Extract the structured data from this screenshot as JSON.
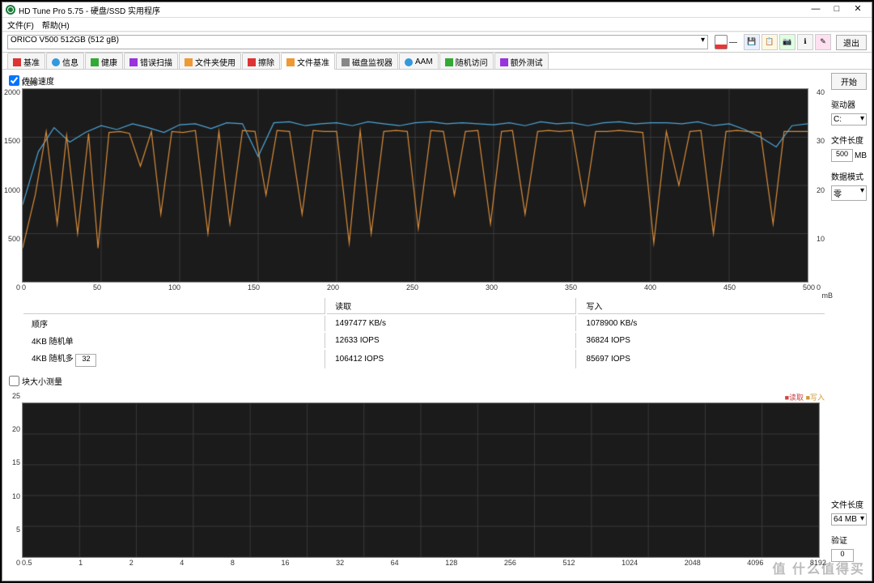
{
  "title": "HD Tune Pro 5.75 - 硬盘/SSD 实用程序",
  "menu": {
    "file": "文件(F)",
    "help": "帮助(H)"
  },
  "drive": "ORICO V500 512GB (512 gB)",
  "exit_btn": "退出",
  "tabs": [
    {
      "label": "基准"
    },
    {
      "label": "信息"
    },
    {
      "label": "健康"
    },
    {
      "label": "错误扫描"
    },
    {
      "label": "文件夹使用"
    },
    {
      "label": "擦除"
    },
    {
      "label": "文件基准"
    },
    {
      "label": "磁盘监视器"
    },
    {
      "label": "AAM"
    },
    {
      "label": "随机访问"
    },
    {
      "label": "额外测试"
    }
  ],
  "active_tab": 6,
  "checkbox1": {
    "label": "传输速度",
    "checked": true
  },
  "checkbox2": {
    "label": "块大小测量",
    "checked": false
  },
  "start_btn": "开始",
  "sidebar": {
    "drive_label": "驱动器",
    "drive_value": "C:",
    "filelen_label": "文件长度",
    "filelen_value": "500",
    "filelen_unit": "MB",
    "datamode_label": "数据模式",
    "datamode_value": "零",
    "filelen2_label": "文件长度",
    "filelen2_value": "64 MB",
    "verify_label": "验证",
    "verify_value": "0"
  },
  "table": {
    "cols": [
      "",
      "读取",
      "写入"
    ],
    "rows": [
      {
        "label": "顺序",
        "read": "1497477 KB/s",
        "write": "1078900 KB/s"
      },
      {
        "label": "4KB 随机单",
        "read": "12633 IOPS",
        "write": "36824 IOPS"
      },
      {
        "label": "4KB 随机多",
        "read": "106412 IOPS",
        "write": "85697 IOPS"
      }
    ],
    "spinner": "32"
  },
  "legend2": {
    "read": "■读取",
    "write": "■写入"
  },
  "chart_data": [
    {
      "type": "line",
      "title": "传输速度",
      "ylabel": "KB/s",
      "yunit": "KB/s",
      "ylim": [
        0,
        2000
      ],
      "yticks": [
        0,
        500,
        1000,
        1500,
        2000
      ],
      "y2lim": [
        0,
        40
      ],
      "y2ticks": [
        0,
        10,
        20,
        30,
        40
      ],
      "xlim": [
        0,
        500
      ],
      "xticks": [
        0,
        50,
        100,
        150,
        200,
        250,
        300,
        350,
        400,
        450,
        500
      ],
      "xunit": "mB",
      "series": [
        {
          "name": "read",
          "color": "#4da6d9",
          "values": [
            [
              0,
              800
            ],
            [
              10,
              1350
            ],
            [
              20,
              1600
            ],
            [
              30,
              1450
            ],
            [
              40,
              1550
            ],
            [
              50,
              1620
            ],
            [
              60,
              1580
            ],
            [
              70,
              1640
            ],
            [
              80,
              1600
            ],
            [
              90,
              1550
            ],
            [
              100,
              1630
            ],
            [
              110,
              1640
            ],
            [
              120,
              1590
            ],
            [
              130,
              1650
            ],
            [
              140,
              1640
            ],
            [
              150,
              1300
            ],
            [
              160,
              1650
            ],
            [
              170,
              1660
            ],
            [
              180,
              1620
            ],
            [
              190,
              1640
            ],
            [
              200,
              1650
            ],
            [
              210,
              1620
            ],
            [
              220,
              1660
            ],
            [
              230,
              1640
            ],
            [
              240,
              1620
            ],
            [
              250,
              1650
            ],
            [
              260,
              1660
            ],
            [
              270,
              1640
            ],
            [
              280,
              1650
            ],
            [
              290,
              1640
            ],
            [
              300,
              1630
            ],
            [
              310,
              1650
            ],
            [
              320,
              1620
            ],
            [
              330,
              1660
            ],
            [
              340,
              1640
            ],
            [
              350,
              1650
            ],
            [
              360,
              1620
            ],
            [
              370,
              1650
            ],
            [
              380,
              1660
            ],
            [
              390,
              1640
            ],
            [
              400,
              1650
            ],
            [
              410,
              1650
            ],
            [
              420,
              1640
            ],
            [
              430,
              1660
            ],
            [
              440,
              1620
            ],
            [
              450,
              1640
            ],
            [
              460,
              1580
            ],
            [
              470,
              1500
            ],
            [
              480,
              1400
            ],
            [
              490,
              1620
            ],
            [
              500,
              1640
            ]
          ]
        },
        {
          "name": "write",
          "color": "#d98c3a",
          "values": [
            [
              0,
              350
            ],
            [
              8,
              900
            ],
            [
              15,
              1560
            ],
            [
              22,
              600
            ],
            [
              28,
              1520
            ],
            [
              35,
              500
            ],
            [
              42,
              1540
            ],
            [
              48,
              350
            ],
            [
              55,
              1550
            ],
            [
              62,
              1560
            ],
            [
              68,
              1540
            ],
            [
              75,
              1200
            ],
            [
              82,
              1560
            ],
            [
              88,
              700
            ],
            [
              95,
              1560
            ],
            [
              102,
              1550
            ],
            [
              110,
              1570
            ],
            [
              118,
              500
            ],
            [
              125,
              1560
            ],
            [
              132,
              600
            ],
            [
              140,
              1570
            ],
            [
              148,
              1560
            ],
            [
              155,
              900
            ],
            [
              162,
              1570
            ],
            [
              170,
              1560
            ],
            [
              178,
              700
            ],
            [
              185,
              1570
            ],
            [
              192,
              1560
            ],
            [
              200,
              1560
            ],
            [
              208,
              400
            ],
            [
              215,
              1570
            ],
            [
              222,
              500
            ],
            [
              230,
              1560
            ],
            [
              238,
              1570
            ],
            [
              245,
              1560
            ],
            [
              252,
              550
            ],
            [
              260,
              1570
            ],
            [
              268,
              1560
            ],
            [
              275,
              900
            ],
            [
              282,
              1560
            ],
            [
              290,
              1570
            ],
            [
              298,
              600
            ],
            [
              305,
              1560
            ],
            [
              312,
              1570
            ],
            [
              320,
              700
            ],
            [
              328,
              1560
            ],
            [
              335,
              1570
            ],
            [
              342,
              1560
            ],
            [
              350,
              1570
            ],
            [
              358,
              800
            ],
            [
              365,
              1560
            ],
            [
              372,
              1560
            ],
            [
              380,
              1570
            ],
            [
              388,
              1560
            ],
            [
              395,
              1550
            ],
            [
              402,
              400
            ],
            [
              410,
              1560
            ],
            [
              418,
              1000
            ],
            [
              425,
              1560
            ],
            [
              432,
              1570
            ],
            [
              440,
              500
            ],
            [
              448,
              1560
            ],
            [
              455,
              1570
            ],
            [
              462,
              1560
            ],
            [
              470,
              1550
            ],
            [
              478,
              600
            ],
            [
              485,
              1560
            ],
            [
              492,
              1560
            ],
            [
              500,
              1560
            ]
          ]
        }
      ]
    },
    {
      "type": "line",
      "title": "块大小测量",
      "ylabel": "",
      "ylim": [
        0,
        25
      ],
      "yticks": [
        0,
        5,
        10,
        15,
        20,
        25
      ],
      "x_log": true,
      "xticks": [
        0.5,
        1,
        2,
        4,
        8,
        16,
        32,
        64,
        128,
        256,
        512,
        1024,
        2048,
        4096,
        8192
      ],
      "series": []
    }
  ]
}
